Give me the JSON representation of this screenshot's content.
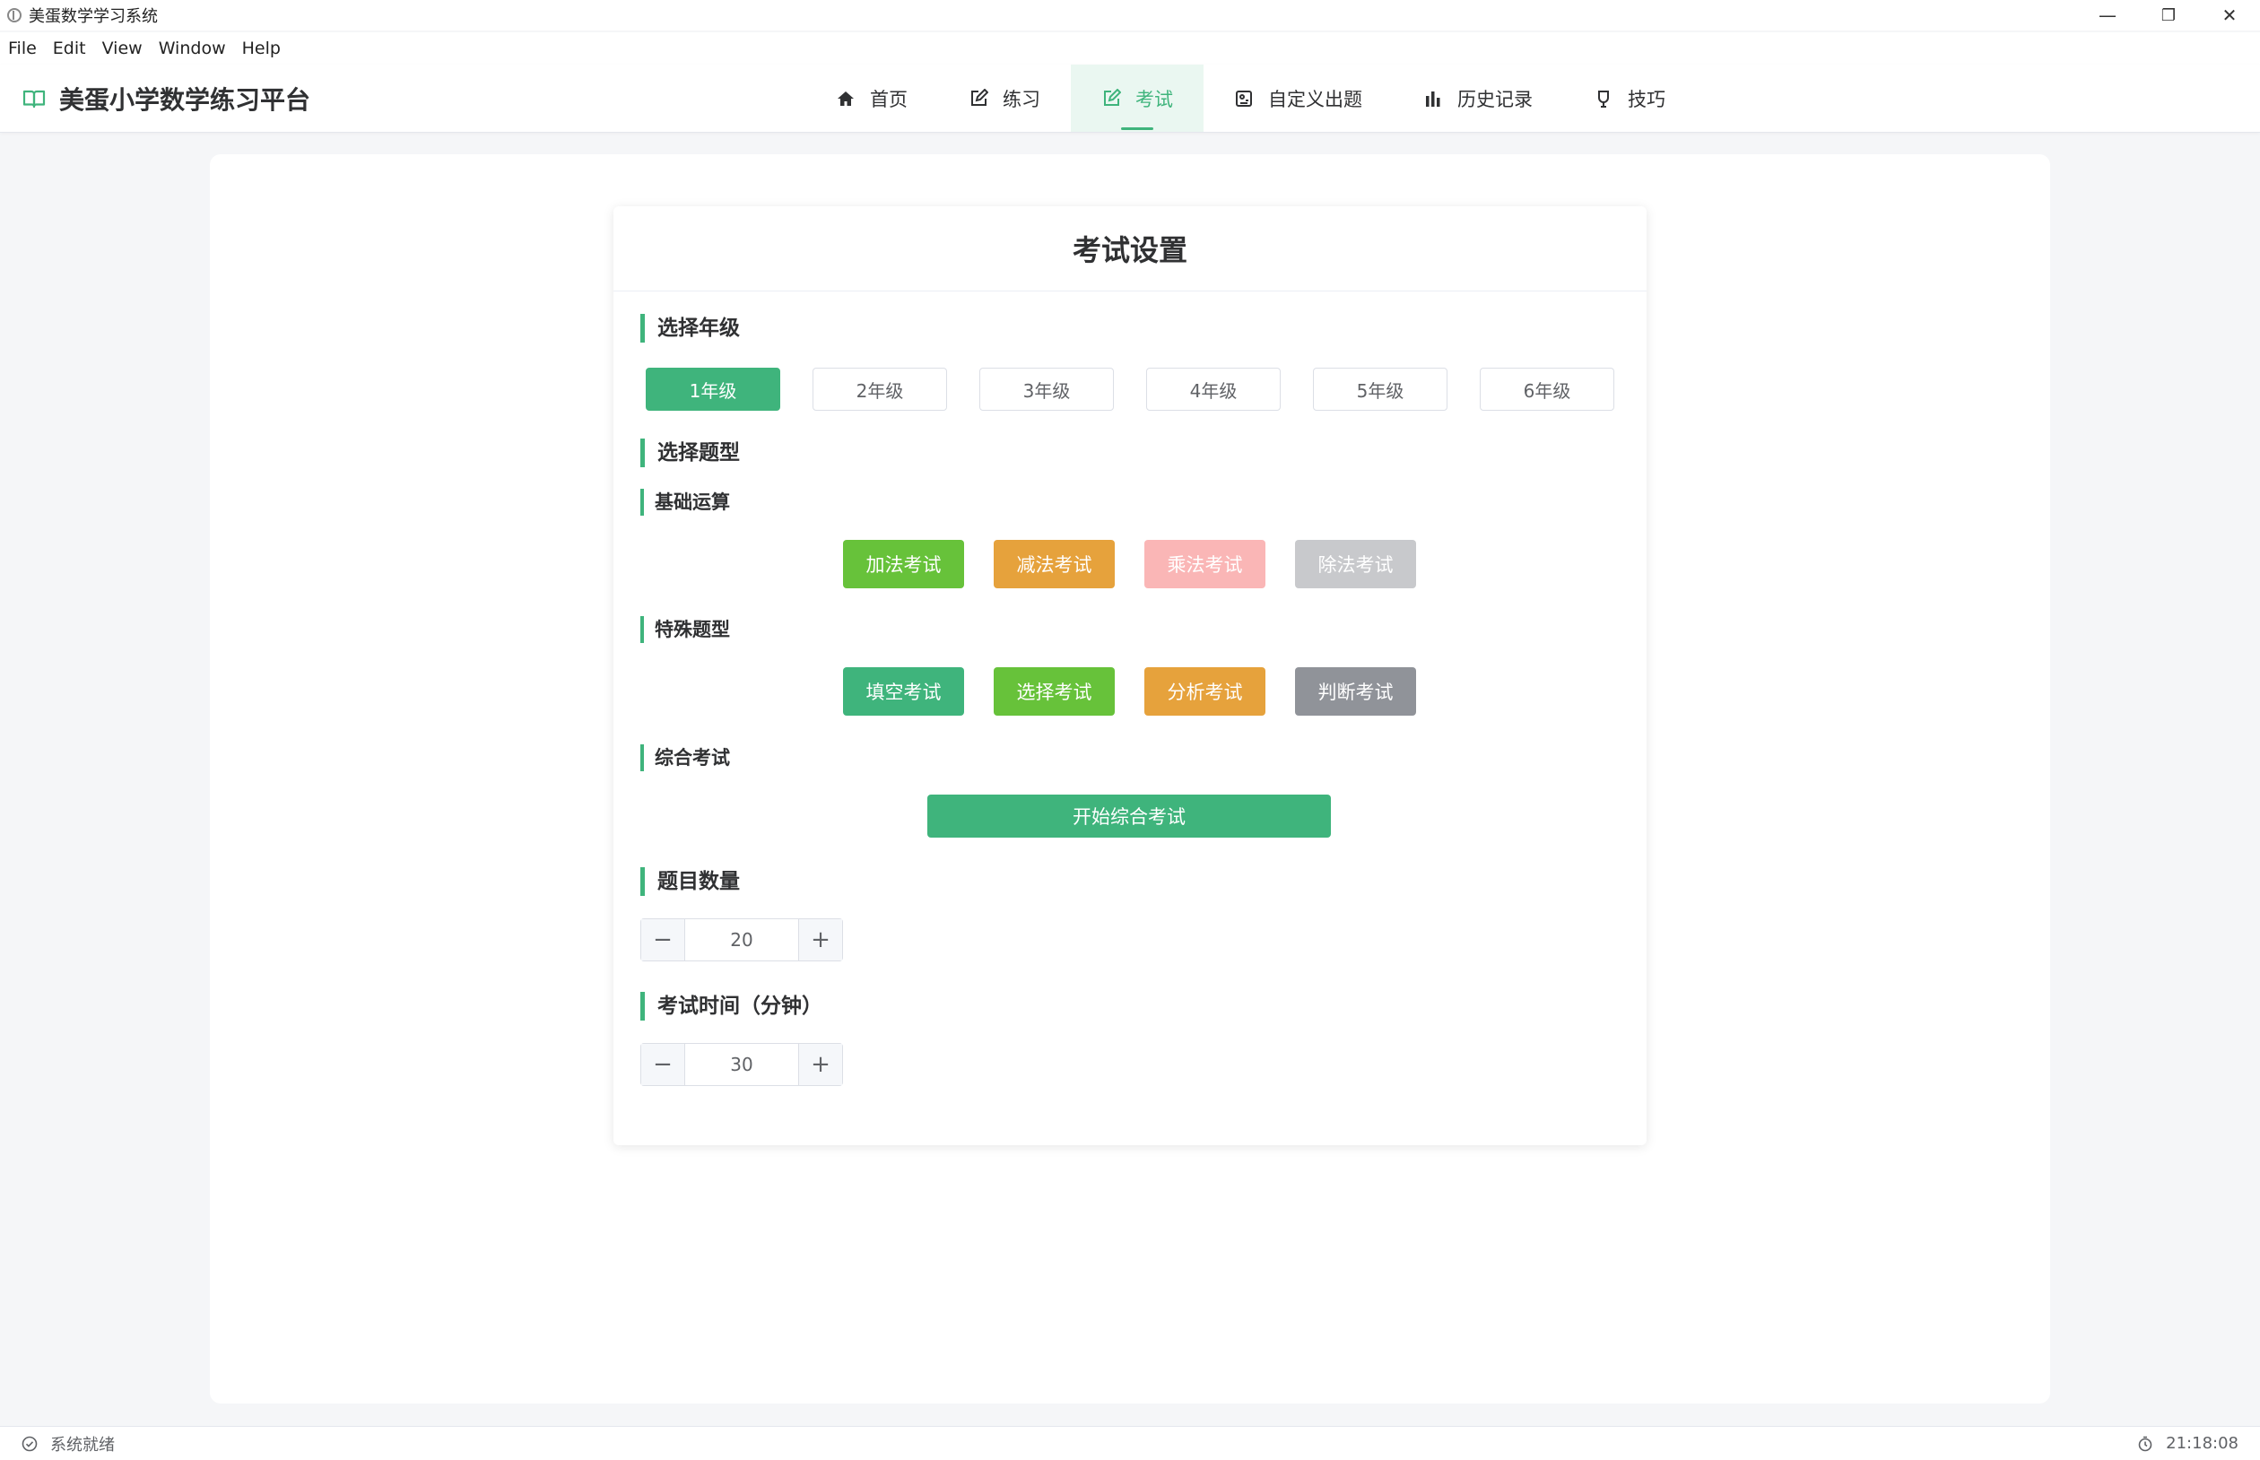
{
  "window": {
    "title": "美蛋数学学习系统",
    "controls": {
      "minimize": "—",
      "restore": "❐",
      "close": "✕"
    }
  },
  "menu": [
    "File",
    "Edit",
    "View",
    "Window",
    "Help"
  ],
  "header": {
    "brand": "美蛋小学数学练习平台",
    "nav": [
      {
        "label": "首页",
        "icon": "home-icon"
      },
      {
        "label": "练习",
        "icon": "edit-icon"
      },
      {
        "label": "考试",
        "icon": "edit-icon",
        "active": true
      },
      {
        "label": "自定义出题",
        "icon": "custom-icon"
      },
      {
        "label": "历史记录",
        "icon": "chart-icon"
      },
      {
        "label": "技巧",
        "icon": "tip-icon"
      }
    ]
  },
  "exam": {
    "title": "考试设置",
    "grade_section": "选择年级",
    "grades": [
      "1年级",
      "2年级",
      "3年级",
      "4年级",
      "5年级",
      "6年级"
    ],
    "selected_grade": "1年级",
    "type_section": "选择题型",
    "basic": {
      "title": "基础运算",
      "buttons": [
        {
          "label": "加法考试",
          "color": "#67c23a"
        },
        {
          "label": "减法考试",
          "color": "#e6a23c"
        },
        {
          "label": "乘法考试",
          "color": "#fab6b6"
        },
        {
          "label": "除法考试",
          "color": "#c8c9cc"
        }
      ]
    },
    "special": {
      "title": "特殊题型",
      "buttons": [
        {
          "label": "填空考试",
          "color": "#3fb47c"
        },
        {
          "label": "选择考试",
          "color": "#67c23a"
        },
        {
          "label": "分析考试",
          "color": "#e6a23c"
        },
        {
          "label": "判断考试",
          "color": "#909399"
        }
      ]
    },
    "comprehensive": {
      "title": "综合考试",
      "button": "开始综合考试"
    },
    "question_count": {
      "title": "题目数量",
      "value": "20",
      "minus": "−",
      "plus": "+"
    },
    "duration": {
      "title": "考试时间（分钟）",
      "value": "30",
      "minus": "−",
      "plus": "+"
    }
  },
  "status": {
    "left": "系统就绪",
    "time": "21:18:08"
  },
  "colors": {
    "accent": "#3fb47c"
  }
}
